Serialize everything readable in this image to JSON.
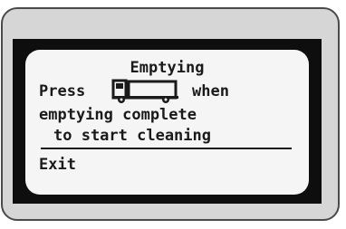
{
  "display": {
    "title": "Emptying",
    "line_press": "Press",
    "line_when": "when",
    "line_3": "emptying complete",
    "line_4": "to start cleaning",
    "softkey_exit": "Exit",
    "icon": "truck-icon"
  },
  "colors": {
    "bezel": "#0e0e0e",
    "screen": "#f5f5f5",
    "casing": "#d6d6d6",
    "text": "#1a1a1a"
  }
}
